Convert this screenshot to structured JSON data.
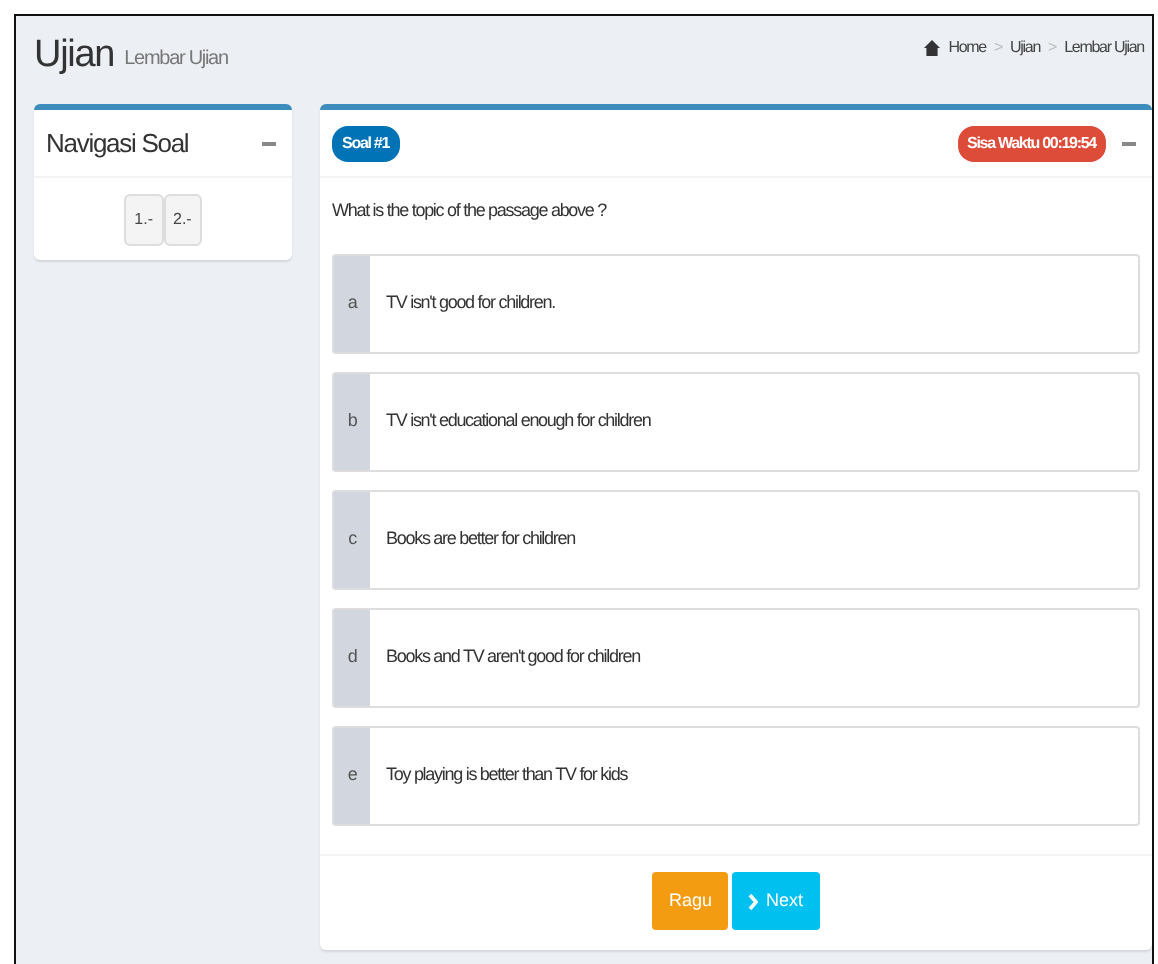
{
  "header": {
    "title": "Ujian",
    "subtitle": "Lembar Ujian"
  },
  "breadcrumb": {
    "separator": ">",
    "items": [
      "Home",
      "Ujian",
      "Lembar Ujian"
    ]
  },
  "navigation": {
    "title": "Navigasi Soal",
    "items": [
      {
        "label": "1.-",
        "selected": false
      },
      {
        "label": "2.-",
        "selected": false
      }
    ]
  },
  "question": {
    "badge": "Soal #1",
    "timer": "Sisa Waktu 00:19:54",
    "text": "What is the topic of the passage above ?",
    "options": [
      {
        "letter": "a",
        "text": "TV isn't good for children.",
        "selected": false
      },
      {
        "letter": "b",
        "text": "TV isn't educational enough for children",
        "selected": false
      },
      {
        "letter": "c",
        "text": "Books are better for children",
        "selected": false
      },
      {
        "letter": "d",
        "text": "Books and TV aren't good for children",
        "selected": false
      },
      {
        "letter": "e",
        "text": "Toy playing is better than TV for kids",
        "selected": false
      }
    ]
  },
  "buttons": [
    {
      "kind": "doubt",
      "label": "Ragu"
    },
    {
      "kind": "next",
      "label": "Next"
    }
  ]
}
